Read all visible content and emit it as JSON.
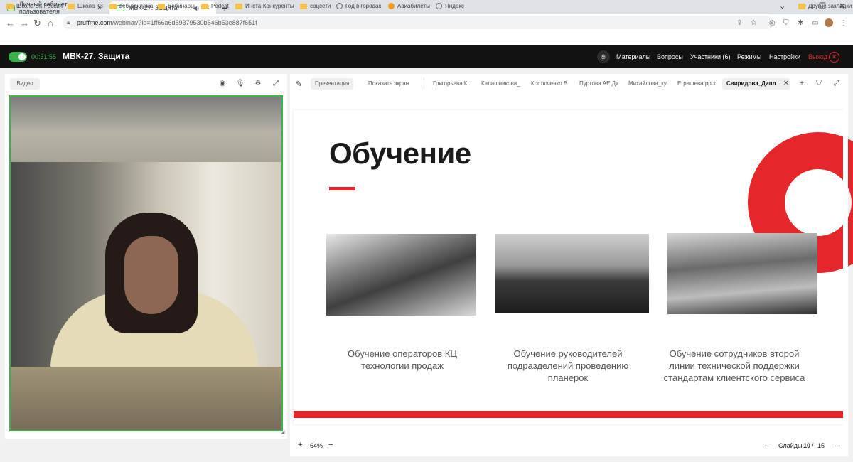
{
  "browser": {
    "tabs": [
      {
        "title": "Личный кабинет пользователя"
      },
      {
        "title": "МВК-27. Защита"
      }
    ],
    "new_tab": "+",
    "url_host": "pruffme.com",
    "url_path": "/webinar/?id=1ff66a6d59379530b646b53e887f651f",
    "bookmarks": [
      "Школа ВК Россия",
      "Школа КЗ",
      "веб-реклама",
      "Вебинары",
      "Podcat",
      "Инста-Конкуренты",
      "соцсети",
      "Год в городах",
      "Авиабилеты",
      "Яндекс"
    ],
    "other_bookmarks": "Другие закладки"
  },
  "webinar": {
    "timer": "00:31:55",
    "title": "МВК-27. Защита",
    "menu": {
      "materials": "Материалы",
      "questions": "Вопросы",
      "participants": "Участники (6)",
      "modes": "Режимы",
      "settings": "Настройки",
      "exit": "Выход"
    }
  },
  "video_panel": {
    "label": "Видео"
  },
  "slides_panel": {
    "tabs": [
      "Презентация",
      "Показать экран"
    ],
    "files": [
      "Григорьева К..",
      "Калашникова_",
      "Костюченко В",
      "Пуртова АЕ Ди",
      "Михайлова_ку",
      "Еграшева.pptx",
      "Свиридова_Дипл"
    ],
    "active_file_index": 6,
    "zoom_level": "64%",
    "slides_label": "Слайды",
    "current_slide": "10",
    "slide_separator": "/",
    "total_slides": "15"
  },
  "slide": {
    "title": "Обучение",
    "captions": [
      [
        "Обучение операторов КЦ",
        "технологии продаж"
      ],
      [
        "Обучение руководителей",
        "подразделений проведению",
        "планерок"
      ],
      [
        "Обучение сотрудников второй",
        "линии технической поддержки",
        "стандартам клиентского сервиса"
      ]
    ]
  },
  "colors": {
    "accent_red": "#e5262b",
    "live_green": "#3cb34a",
    "header_bg": "#121212"
  }
}
